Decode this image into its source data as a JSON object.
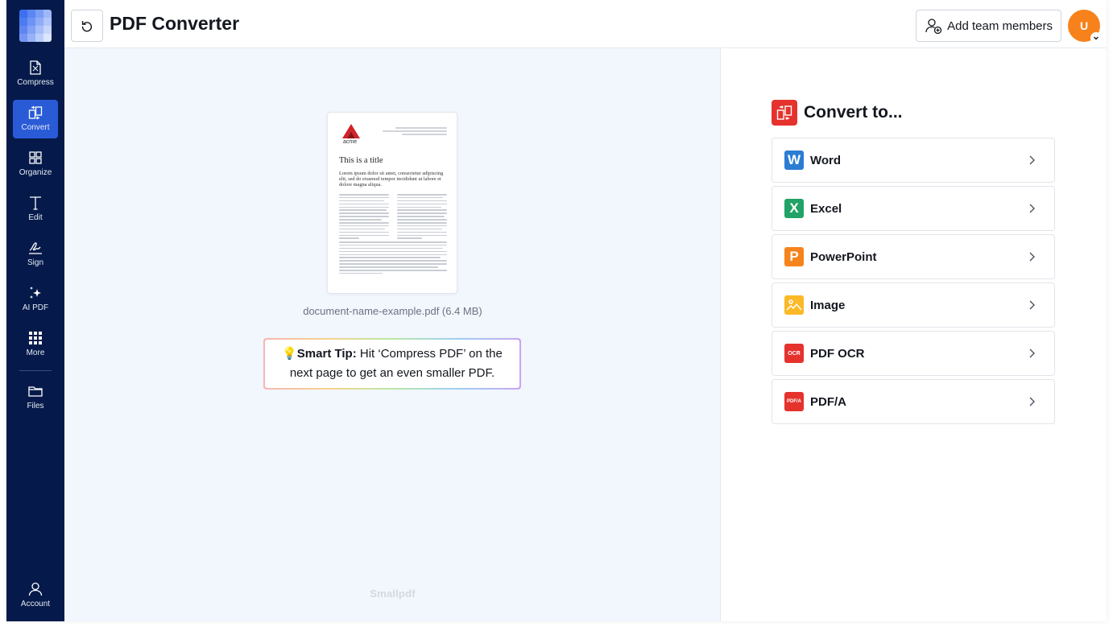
{
  "header": {
    "title": "PDF Converter",
    "team_button": "Add team members",
    "avatar_initial": "U"
  },
  "sidebar": {
    "items": [
      {
        "label": "Compress",
        "icon": "compress-icon"
      },
      {
        "label": "Convert",
        "icon": "convert-icon",
        "active": true
      },
      {
        "label": "Organize",
        "icon": "organize-icon"
      },
      {
        "label": "Edit",
        "icon": "edit-text-icon"
      },
      {
        "label": "Sign",
        "icon": "signature-icon"
      },
      {
        "label": "AI PDF",
        "icon": "sparkle-icon"
      },
      {
        "label": "More",
        "icon": "grid-dots-icon"
      },
      {
        "label": "Files",
        "icon": "folder-icon"
      },
      {
        "label": "Account",
        "icon": "user-icon"
      }
    ]
  },
  "document": {
    "file_name": "document-name-example.pdf (6.4 MB)",
    "preview_logo": "acme",
    "preview_title": "This is a title",
    "preview_intro": "Lorem ipsum dolor sit amet, consectetur adipiscing elit, sed do eiusmod tempor incididunt ut labore et dolore magna aliqua."
  },
  "smart_tip": {
    "emoji": "💡",
    "label": "Smart Tip:",
    "text": " Hit ‘Compress PDF’ on the next page to get an even smaller PDF."
  },
  "watermark": "Smallpdf",
  "convert": {
    "heading": "Convert to...",
    "options": [
      {
        "label": "Word",
        "badge": "W",
        "color": "#2b7cd3",
        "icon": "word-icon"
      },
      {
        "label": "Excel",
        "badge": "X",
        "color": "#21a366",
        "icon": "excel-icon"
      },
      {
        "label": "PowerPoint",
        "badge": "P",
        "color": "#f6831b",
        "icon": "powerpoint-icon"
      },
      {
        "label": "Image",
        "badge": "",
        "color": "#fbb827",
        "icon": "image-icon"
      },
      {
        "label": "PDF OCR",
        "badge": "OCR",
        "color": "#e5322d",
        "icon": "ocr-icon"
      },
      {
        "label": "PDF/A",
        "badge": "PDF/A",
        "color": "#e5322d",
        "icon": "pdfa-icon"
      }
    ]
  },
  "colors": {
    "sidebar_bg": "#051a4a",
    "sidebar_active": "#2a5bd7",
    "content_bg": "#f2f6fd",
    "accent_red": "#e5322d",
    "avatar": "#f7821b"
  }
}
